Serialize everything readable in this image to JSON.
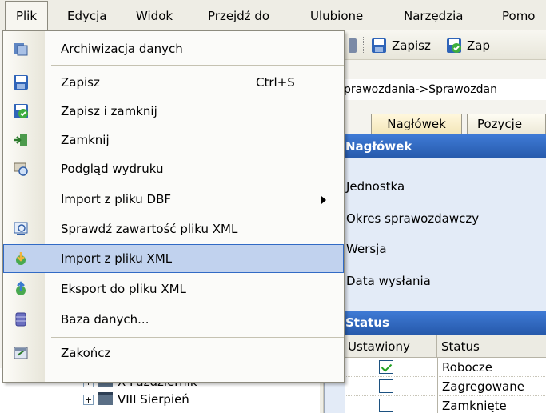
{
  "menubar": {
    "items": [
      {
        "label": "Plik"
      },
      {
        "label": "Edycja"
      },
      {
        "label": "Widok"
      },
      {
        "label": "Przejdź do"
      },
      {
        "label": "Ulubione"
      },
      {
        "label": "Narzędzia"
      },
      {
        "label": "Pomo"
      }
    ]
  },
  "toolbar": {
    "save_label": "Zapisz",
    "save_close_label": "Zap"
  },
  "breadcrumb": "prawozdania->Sprawozdan",
  "tabs": [
    {
      "label": "Nagłówek"
    },
    {
      "label": "Pozycje"
    }
  ],
  "header_section": {
    "title": "Nagłówek",
    "fields": [
      "Jednostka",
      "Okres sprawozdawczy",
      "Wersja",
      "Data wysłania"
    ]
  },
  "status_section": {
    "title": "Status",
    "columns": [
      "Ustawiony",
      "Status"
    ],
    "rows": [
      {
        "checked": true,
        "status": "Robocze"
      },
      {
        "checked": false,
        "status": "Zagregowane"
      },
      {
        "checked": false,
        "status": "Zamknięte"
      }
    ]
  },
  "tree": {
    "items": [
      {
        "label": "X Październik"
      },
      {
        "label": "VIII Sierpień"
      }
    ]
  },
  "file_menu": {
    "items": [
      {
        "label": "Archiwizacja danych",
        "icon": "archive-icon"
      },
      {
        "label": "Zapisz",
        "shortcut": "Ctrl+S",
        "icon": "save-icon"
      },
      {
        "label": "Zapisz i zamknij",
        "icon": "save-close-icon"
      },
      {
        "label": "Zamknij",
        "icon": "close-icon"
      },
      {
        "label": "Podgląd wydruku",
        "icon": "print-preview-icon"
      },
      {
        "label": "Import z pliku DBF",
        "submenu": true
      },
      {
        "label": "Sprawdź zawartość pliku XML",
        "icon": "check-xml-icon"
      },
      {
        "label": "Import z pliku XML",
        "icon": "import-xml-icon",
        "highlighted": true
      },
      {
        "label": "Eksport do pliku XML",
        "icon": "export-xml-icon"
      },
      {
        "label": "Baza danych...",
        "icon": "database-icon"
      },
      {
        "label": "Zakończ",
        "icon": "exit-icon"
      }
    ]
  },
  "colors": {
    "menu_highlight": "#c1d2ee",
    "section_header": "#2e66bf",
    "panel_bg": "#e3ebf7"
  }
}
